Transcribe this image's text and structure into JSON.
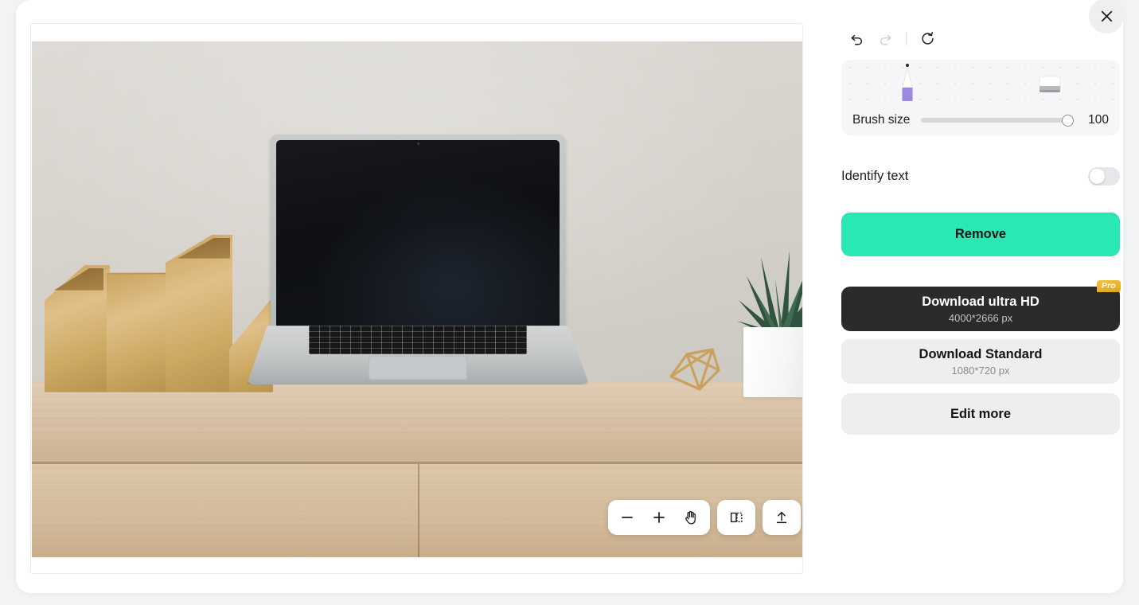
{
  "history": {
    "undo_label": "Undo",
    "redo_label": "Redo",
    "reset_label": "Reset"
  },
  "brush_panel": {
    "brush_tool_label": "Brush",
    "eraser_tool_label": "Eraser",
    "size_label": "Brush size",
    "size_value": "100",
    "brush_color": "#9b8ae0"
  },
  "identify": {
    "label": "Identify text",
    "state": "off"
  },
  "actions": {
    "remove_label": "Remove",
    "remove_color": "#2ae8b4",
    "ultra_hd_label": "Download ultra HD",
    "ultra_hd_size": "4000*2666 px",
    "pro_badge": "Pro",
    "pro_badge_color": "#edb02a",
    "standard_label": "Download Standard",
    "standard_size": "1080*720 px",
    "edit_more_label": "Edit more"
  },
  "canvas_toolbar": {
    "zoom_out_label": "Zoom out",
    "zoom_in_label": "Zoom in",
    "pan_label": "Pan",
    "compare_label": "Compare before and after",
    "upload_label": "Upload new image"
  },
  "close": {
    "label": "Close"
  },
  "photo": {
    "description": "Laptop with a dark screen on a light oak desk, gold magazine file holders at left, a gold geometric ornament and a succulent in a white square pot at right"
  }
}
